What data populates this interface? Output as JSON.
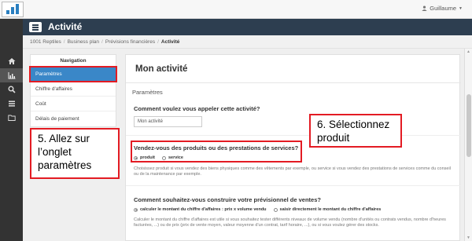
{
  "topbar": {
    "user_name": "Guillaume"
  },
  "titlebar": {
    "title": "Activité"
  },
  "breadcrumb": [
    "1001 Reptiles",
    "Business plan",
    "Prévisions financières",
    "Activité"
  ],
  "navigation": {
    "heading": "Navigation",
    "items": [
      {
        "label": "Paramètres",
        "active": true
      },
      {
        "label": "Chiffre d'affaires",
        "active": false
      },
      {
        "label": "Coût",
        "active": false
      },
      {
        "label": "Délais de paiement",
        "active": false
      }
    ]
  },
  "main": {
    "title": "Mon activité",
    "section": "Paramètres",
    "q1": {
      "label": "Comment voulez vous appeler cette activité?",
      "value": "Mon activité"
    },
    "q2": {
      "label": "Vendez-vous des produits ou des prestations de services?",
      "options": [
        {
          "label": "produit",
          "checked": true
        },
        {
          "label": "service",
          "checked": false
        }
      ],
      "help": "Choisissez produit si vous vendez des biens physiques comme des vêtements par exemple, ou service si vous vendez des prestations de services comme du conseil ou de la maintenance par exemple."
    },
    "q3": {
      "label": "Comment souhaitez-vous construire votre prévisionnel de ventes?",
      "options": [
        {
          "label": "calculer le montant du chiffre d'affaires : prix x volume vendu",
          "checked": true
        },
        {
          "label": "saisir directement le montant du chiffre d'affaires",
          "checked": false
        }
      ],
      "help": "Calculer le montant du chiffre d'affaires est utile si vous souhaitez tester différents niveaux de volume vendu (nombre d'unités ou contrats vendus, nombre d'heures facturées, ...) ou de prix (prix de vente moyen, valeur moyenne d'un contrat, tarif horaire, ...), ou si vous voulez gérer des stocks."
    }
  },
  "annotations": {
    "step5": "5. Allez sur l’onglet paramètres",
    "step6": "6. Sélectionnez produit"
  },
  "colors": {
    "accent": "#3a87c8",
    "titlebar": "#2d3e50",
    "rail": "#333333",
    "annotation": "#e31b23"
  },
  "icons": [
    "home-icon",
    "chart-icon",
    "search-icon",
    "list-icon",
    "folder-icon",
    "user-icon",
    "menu-icon"
  ]
}
